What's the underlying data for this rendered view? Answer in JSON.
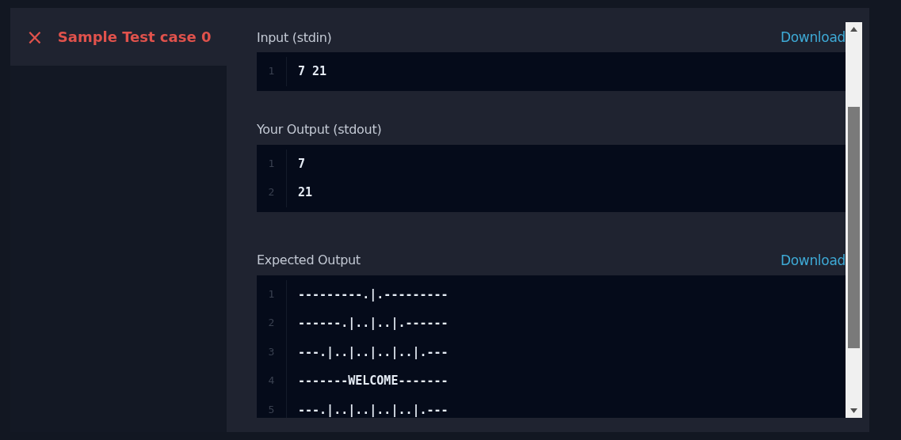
{
  "sidebar": {
    "close_icon_text": "×",
    "title": "Sample Test case 0"
  },
  "sections": [
    {
      "label": "Input (stdin)",
      "download": "Download",
      "lines": [
        {
          "number": "1",
          "text": "7 21"
        }
      ]
    },
    {
      "label": "Your Output (stdout)",
      "lines": [
        {
          "number": "1",
          "text": "7"
        },
        {
          "number": "2",
          "text": "21"
        }
      ]
    },
    {
      "label": "Expected Output",
      "download": "Download",
      "lines": [
        {
          "number": "1",
          "text": "---------.|.---------"
        },
        {
          "number": "2",
          "text": "------.|..|..|.------"
        },
        {
          "number": "3",
          "text": "---.|..|..|..|..|.---"
        },
        {
          "number": "4",
          "text": "-------WELCOME-------"
        },
        {
          "number": "5",
          "text": "---.|..|..|..|..|.---"
        }
      ]
    }
  ]
}
